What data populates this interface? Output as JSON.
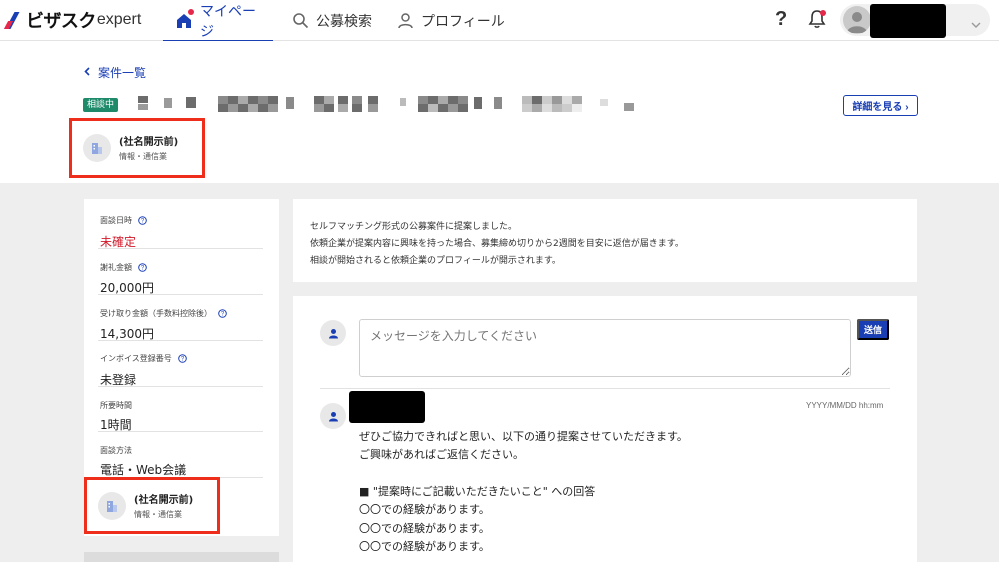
{
  "header": {
    "logo_ja": "ビザスク",
    "logo_en": "expert",
    "nav": [
      {
        "label": "マイページ",
        "icon": "home-icon",
        "active": true
      },
      {
        "label": "公募検索",
        "icon": "search-icon",
        "active": false
      },
      {
        "label": "プロフィール",
        "icon": "person-icon",
        "active": false
      }
    ],
    "help_glyph": "?",
    "accent": "#1a3fb5",
    "alert": "#e6294a"
  },
  "case": {
    "back_label": "案件一覧",
    "status_badge": "相談中",
    "detail_button": "詳細を見る ›"
  },
  "company": {
    "name": "(社名開示前)",
    "industry": "情報・通信業"
  },
  "sidebar": {
    "fields": [
      {
        "label": "面談日時",
        "value": "未確定",
        "help": true,
        "red": true
      },
      {
        "label": "謝礼金額",
        "value": "20,000円",
        "help": true
      },
      {
        "label": "受け取り金額（手数料控除後）",
        "value": "14,300円",
        "help": true
      },
      {
        "label": "インボイス登録番号",
        "value": "未登録",
        "help": true
      },
      {
        "label": "所要時間",
        "value": "1時間",
        "help": false
      },
      {
        "label": "面談方法",
        "value": "電話・Web会議",
        "help": false
      }
    ]
  },
  "info": {
    "lines": [
      "セルフマッチング形式の公募案件に提案しました。",
      "依頼企業が提案内容に興味を持った場合、募集締め切りから2週間を目安に返信が届きます。",
      "相談が開始されると依頼企業のプロフィールが開示されます。"
    ]
  },
  "composer": {
    "placeholder": "メッセージを入力してください",
    "send_label": "送信"
  },
  "message": {
    "time": "YYYY/MM/DD hh:mm",
    "lines": [
      "ぜひご協力できればと思い、以下の通り提案させていただきます。",
      "ご興味があればご返信ください。",
      "",
      "■ \"提案時にご記載いただきたいこと\" への回答",
      "〇〇での経験があります。",
      "〇〇での経験があります。",
      "〇〇での経験があります。"
    ]
  }
}
